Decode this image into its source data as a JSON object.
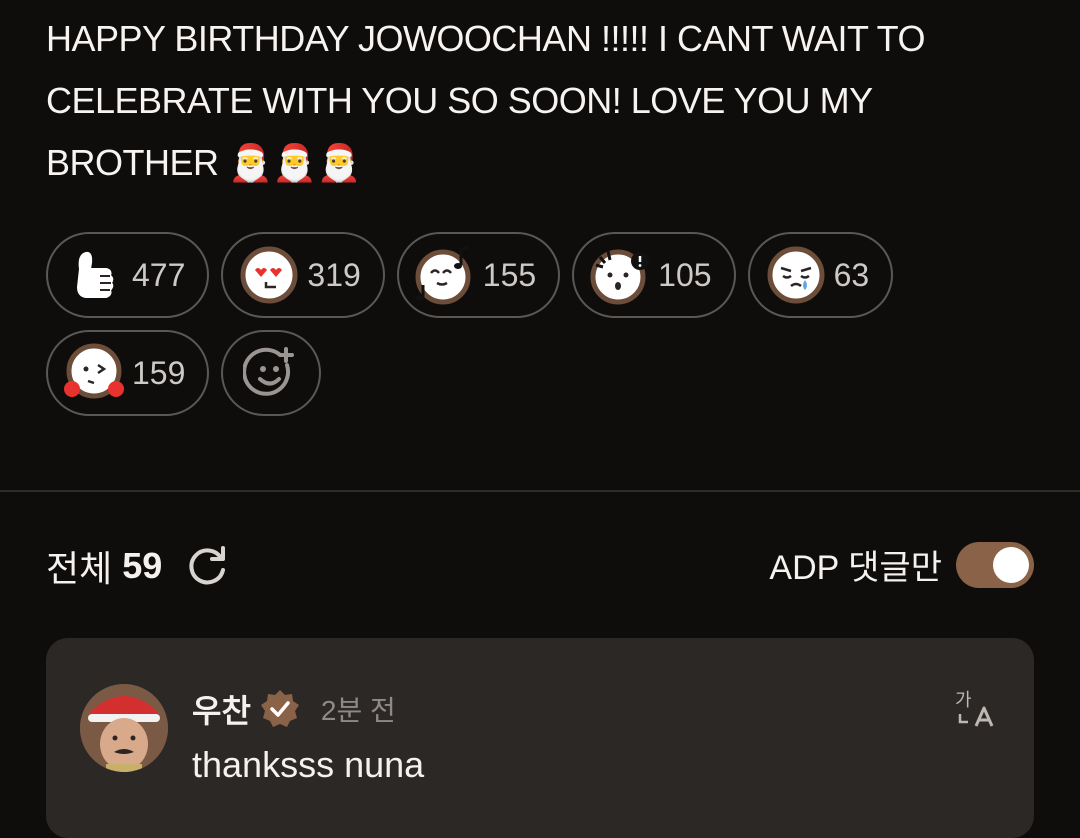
{
  "post": {
    "text": "HAPPY BIRTHDAY JOWOOCHAN !!!!! I CANT WAIT TO CELEBRATE WITH YOU SO SOON! LOVE YOU MY BROTHER 🎅🎅🎅"
  },
  "reactions": [
    {
      "icon": "thumbs-up-icon",
      "count": "477"
    },
    {
      "icon": "heart-eyes-face-icon",
      "count": "319"
    },
    {
      "icon": "music-note-face-icon",
      "count": "155"
    },
    {
      "icon": "surprised-face-icon",
      "count": "105"
    },
    {
      "icon": "crying-face-icon",
      "count": "63"
    },
    {
      "icon": "winking-blush-face-icon",
      "count": "159"
    }
  ],
  "add_reaction_icon": "add-reaction-icon",
  "comments_header": {
    "total_label": "전체",
    "total_count": "59",
    "refresh_icon": "refresh-icon",
    "filter_label": "ADP 댓글만",
    "filter_on": true
  },
  "comment": {
    "author": "우찬",
    "verified": true,
    "time": "2분 전",
    "text": "thanksss nuna",
    "translate_icon": "translate-icon"
  },
  "colors": {
    "background": "#0f0d0c",
    "accent": "#8a6248",
    "card": "#2c2826"
  }
}
